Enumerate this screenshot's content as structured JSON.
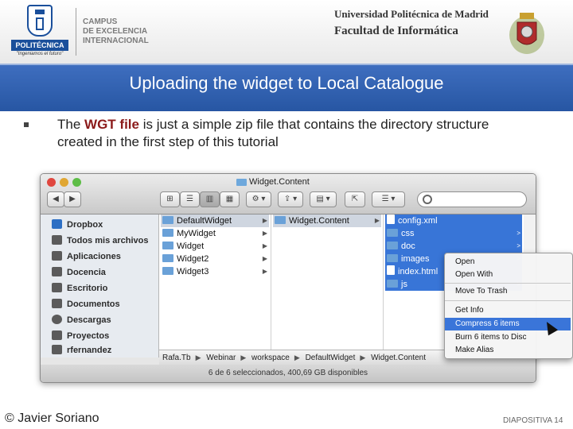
{
  "header": {
    "logo_name": "POLITÉCNICA",
    "logo_slogan": "\"Ingeniamos el futuro\"",
    "campus_lines": [
      "CAMPUS",
      "DE EXCELENCIA",
      "INTERNACIONAL"
    ],
    "university": "Universidad Politécnica de Madrid",
    "faculty": "Facultad de Informática"
  },
  "slide": {
    "title": "Uploading the widget to Local Catalogue",
    "bullet_pre": "The ",
    "bullet_highlight": "WGT file",
    "bullet_post": " is just a simple zip file that contains the directory structure created in the first step of this tutorial"
  },
  "finder": {
    "window_title": "Widget.Content",
    "toolbar": {
      "back": "◀",
      "forward": "▶",
      "view_icons": "⊞",
      "view_list": "☰",
      "view_columns": "▥",
      "view_cover": "▦",
      "action": "⚙ ▾",
      "share": "⇪ ▾",
      "arrange": "▤ ▾",
      "quicklook": "⇱",
      "path": "☰ ▾"
    },
    "sidebar": [
      {
        "label": "Dropbox",
        "icon": "dropbox-icon"
      },
      {
        "label": "Todos mis archivos",
        "icon": "all-files-icon"
      },
      {
        "label": "Aplicaciones",
        "icon": "applications-icon"
      },
      {
        "label": "Docencia",
        "icon": "folder-icon"
      },
      {
        "label": "Escritorio",
        "icon": "desktop-icon"
      },
      {
        "label": "Documentos",
        "icon": "documents-icon"
      },
      {
        "label": "Descargas",
        "icon": "downloads-icon"
      },
      {
        "label": "Proyectos",
        "icon": "folder-icon"
      },
      {
        "label": "rfernandez",
        "icon": "home-icon"
      }
    ],
    "column1": [
      "DefaultWidget",
      "MyWidget",
      "Widget",
      "Widget2",
      "Widget3"
    ],
    "column2": [
      "Widget.Content"
    ],
    "column3": [
      "config.xml",
      "css",
      "doc",
      "images",
      "index.html",
      "js"
    ],
    "pathbar": [
      "Rafa.Tb",
      "Webinar",
      "workspace",
      "DefaultWidget",
      "Widget.Content"
    ],
    "status": "6 de 6 seleccionados, 400,69 GB disponibles"
  },
  "context_menu": {
    "items": [
      "Open",
      "Open With",
      "Move To Trash",
      "Get Info",
      "Compress 6 items",
      "Burn 6 items to Disc",
      "Make Alias"
    ],
    "active_index": 4
  },
  "footer": {
    "author": "© Javier Soriano",
    "slide_number": "DIAPOSITIVA 14"
  },
  "colors": {
    "title_bar": "#2f5fb0",
    "highlight_text": "#8b1a1a",
    "selection": "#3875d7"
  }
}
